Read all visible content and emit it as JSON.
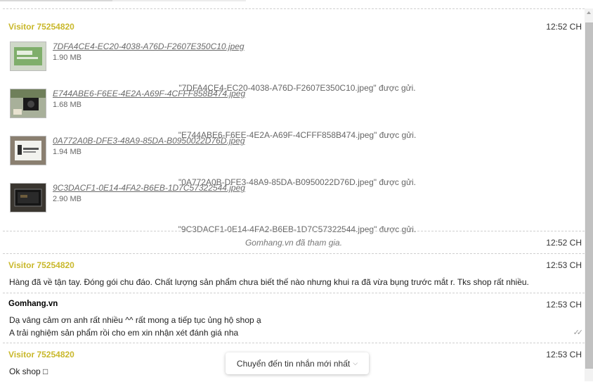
{
  "chat": {
    "blocks": [
      {
        "sender": "Visitor 75254820",
        "time": "12:52 CH",
        "files": [
          {
            "name": "7DFA4CE4-EC20-4038-A76D-F2607E350C10.jpeg",
            "size": "1.90 MB",
            "sent": "\"7DFA4CE4-EC20-4038-A76D-F2607E350C10.jpeg\" được gửi."
          },
          {
            "name": "E744ABE6-F6EE-4E2A-A69F-4CFFF858B474.jpeg",
            "size": "1.68 MB",
            "sent": "\"E744ABE6-F6EE-4E2A-A69F-4CFFF858B474.jpeg\" được gửi."
          },
          {
            "name": "0A772A0B-DFE3-48A9-85DA-B0950022D76D.jpeg",
            "size": "1.94 MB",
            "sent": "\"0A772A0B-DFE3-48A9-85DA-B0950022D76D.jpeg\" được gửi."
          },
          {
            "name": "9C3DACF1-0E14-4FA2-B6EB-1D7C57322544.jpeg",
            "size": "2.90 MB",
            "sent": "\"9C3DACF1-0E14-4FA2-B6EB-1D7C57322544.jpeg\" được gửi."
          }
        ]
      },
      {
        "system": "Gomhang.vn đã tham gia.",
        "time": "12:52 CH"
      },
      {
        "sender": "Visitor 75254820",
        "time": "12:53 CH",
        "text": "Hàng đã về tận tay. Đóng gói chu đáo. Chất lượng sản phẩm chưa biết thế nào nhưng khui ra đã vừa bụng trước mắt r. Tks shop rất nhiều."
      },
      {
        "sender": "Gomhang.vn",
        "time": "12:53 CH",
        "lines": [
          "Dạ vâng cảm ơn anh rất nhiều ^^ rất mong a tiếp tục ủng hộ shop ạ",
          "A trải nghiệm sản phẩm rồi cho em xin nhận xét đánh giá nha"
        ]
      },
      {
        "sender": "Visitor 75254820",
        "time": "12:53 CH",
        "text": "Ok shop □"
      }
    ]
  },
  "jump_button": {
    "label": "Chuyển đến tin nhắn mới nhất"
  },
  "icons": {
    "read_receipt": "double-check-icon",
    "jump_chevron": "chevron-down-icon"
  },
  "colors": {
    "visitor_name": "#c9b82b",
    "staff_name": "#000000"
  }
}
